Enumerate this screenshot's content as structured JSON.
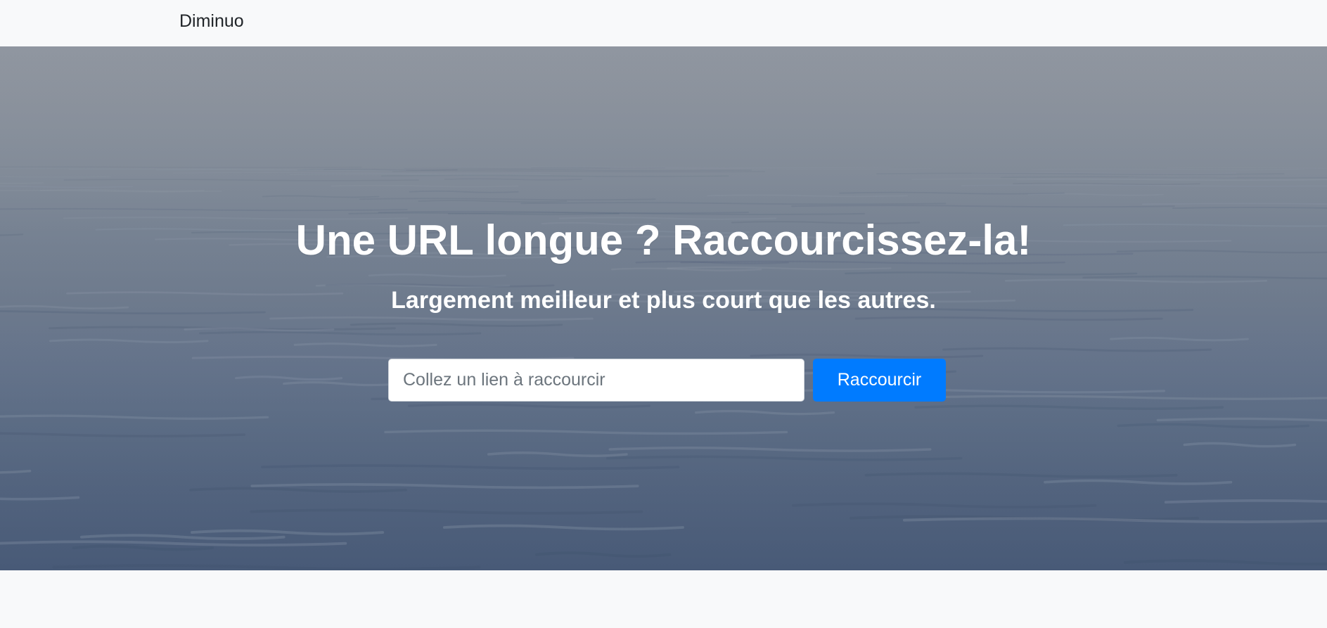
{
  "navbar": {
    "brand": "Diminuo"
  },
  "hero": {
    "title": "Une URL longue ? Raccourcissez-la!",
    "subtitle": "Largement meilleur et plus court que les autres.",
    "form": {
      "input_placeholder": "Collez un lien à raccourcir",
      "input_value": "",
      "submit_label": "Raccourcir"
    }
  },
  "colors": {
    "accent": "#007bff",
    "page_background": "#f8f9fa",
    "hero_top": "#8a919c",
    "hero_bottom": "#485a77",
    "text_on_hero": "#ffffff"
  }
}
